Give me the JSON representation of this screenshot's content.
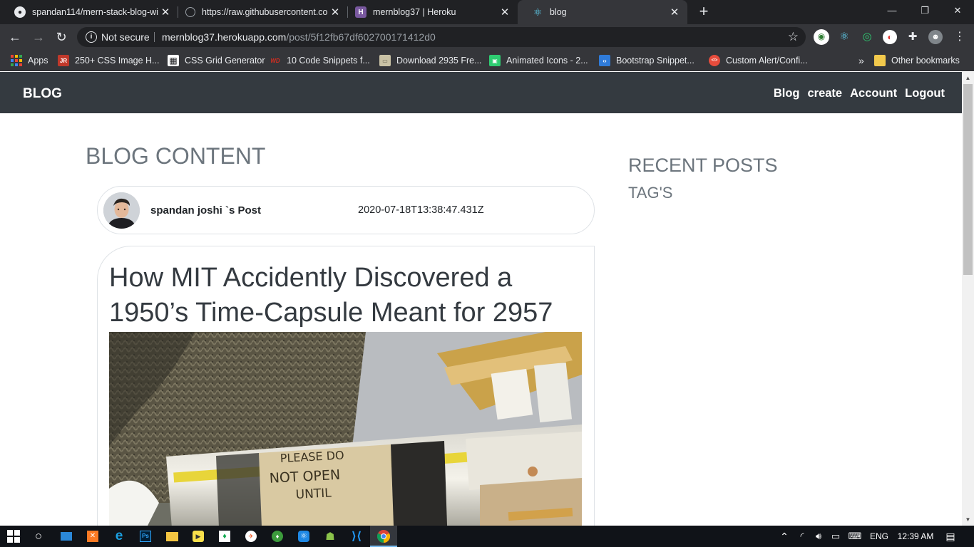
{
  "browser": {
    "tabs": [
      {
        "title": "spandan114/mern-stack-blog-wi",
        "icon": "github-icon",
        "active": false
      },
      {
        "title": "https://raw.githubusercontent.co",
        "icon": "globe-icon",
        "active": false
      },
      {
        "title": "mernblog37 | Heroku",
        "icon": "heroku-icon",
        "active": false
      },
      {
        "title": "blog",
        "icon": "react-icon",
        "active": true
      }
    ],
    "new_tab": "+",
    "window_controls": {
      "minimize": "—",
      "maximize": "❐",
      "close": "✕"
    },
    "security_label": "Not secure",
    "url_host": "mernblog37.herokuapp.com",
    "url_path": "/post/5f12fb67df602700171412d0",
    "bookmarks": [
      {
        "label": "Apps",
        "icon": "apps-grid-icon"
      },
      {
        "label": "250+ CSS Image H...",
        "icon": "jr-icon",
        "color": "#c0392b",
        "glyph": "JR"
      },
      {
        "label": "CSS Grid Generator",
        "icon": "grid-icon",
        "color": "#ffffff",
        "glyph": "▦"
      },
      {
        "label": "10 Code Snippets f...",
        "icon": "wd-icon",
        "color": "#d62d20",
        "glyph": "WD"
      },
      {
        "label": "Download 2935 Fre...",
        "icon": "image-icon",
        "color": "#c9c2a5",
        "glyph": "▭"
      },
      {
        "label": "Animated Icons - 2...",
        "icon": "animated-icons-icon",
        "color": "#2ecc71",
        "glyph": "▣"
      },
      {
        "label": "Bootstrap Snippet...",
        "icon": "bootstrap-icon",
        "color": "#2f7bd9",
        "glyph": "‹›"
      },
      {
        "label": "Custom Alert/Confi...",
        "icon": "code-icon",
        "color": "#e74c3c",
        "glyph": "</>"
      }
    ],
    "bookmarks_overflow": "»",
    "other_bookmarks": "Other bookmarks"
  },
  "site": {
    "brand": "BLOG",
    "nav": [
      "Blog",
      "create",
      "Account",
      "Logout"
    ]
  },
  "main": {
    "heading": "BLOG CONTENT",
    "author": "spandan joshi `s Post",
    "date": "2020-07-18T13:38:47.431Z",
    "post_title": "How MIT Accidently Discovered a 1950’s Time-Capsule Meant for 2957",
    "image_text": [
      "PLEASE DO",
      "NOT OPEN",
      "UNTIL"
    ]
  },
  "sidebar": {
    "recent_heading": "RECENT POSTS",
    "tags_heading": "TAG'S"
  },
  "taskbar": {
    "language": "ENG",
    "time": "12:39 AM"
  },
  "colors": {
    "navbar": "#343a40",
    "heading_gray": "#6c757d",
    "chrome_dark": "#202124",
    "chrome_toolbar": "#35363a"
  }
}
